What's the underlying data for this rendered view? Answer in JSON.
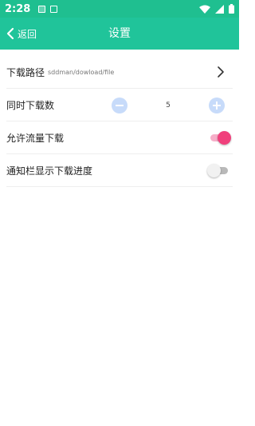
{
  "status_bar": {
    "time": "2:28",
    "notification_icons": [
      "image-icon",
      "document-icon"
    ],
    "indicator_icons": [
      "wifi-icon",
      "signal-icon",
      "battery-icon"
    ]
  },
  "header": {
    "back_label": "返回",
    "title": "设置"
  },
  "settings": {
    "download_path": {
      "label": "下载路径",
      "value": "sddman/dowload/file"
    },
    "concurrent_downloads": {
      "label": "同时下载数",
      "value": "5"
    },
    "allow_mobile_data": {
      "label": "允许流量下载",
      "enabled": true
    },
    "notification_progress": {
      "label": "通知栏显示下载进度",
      "enabled": false
    }
  },
  "colors": {
    "header": "#20c49a",
    "status_bar": "#1fbf90",
    "toggle_on": "#f0407c",
    "stepper": "#c7dbfa"
  }
}
